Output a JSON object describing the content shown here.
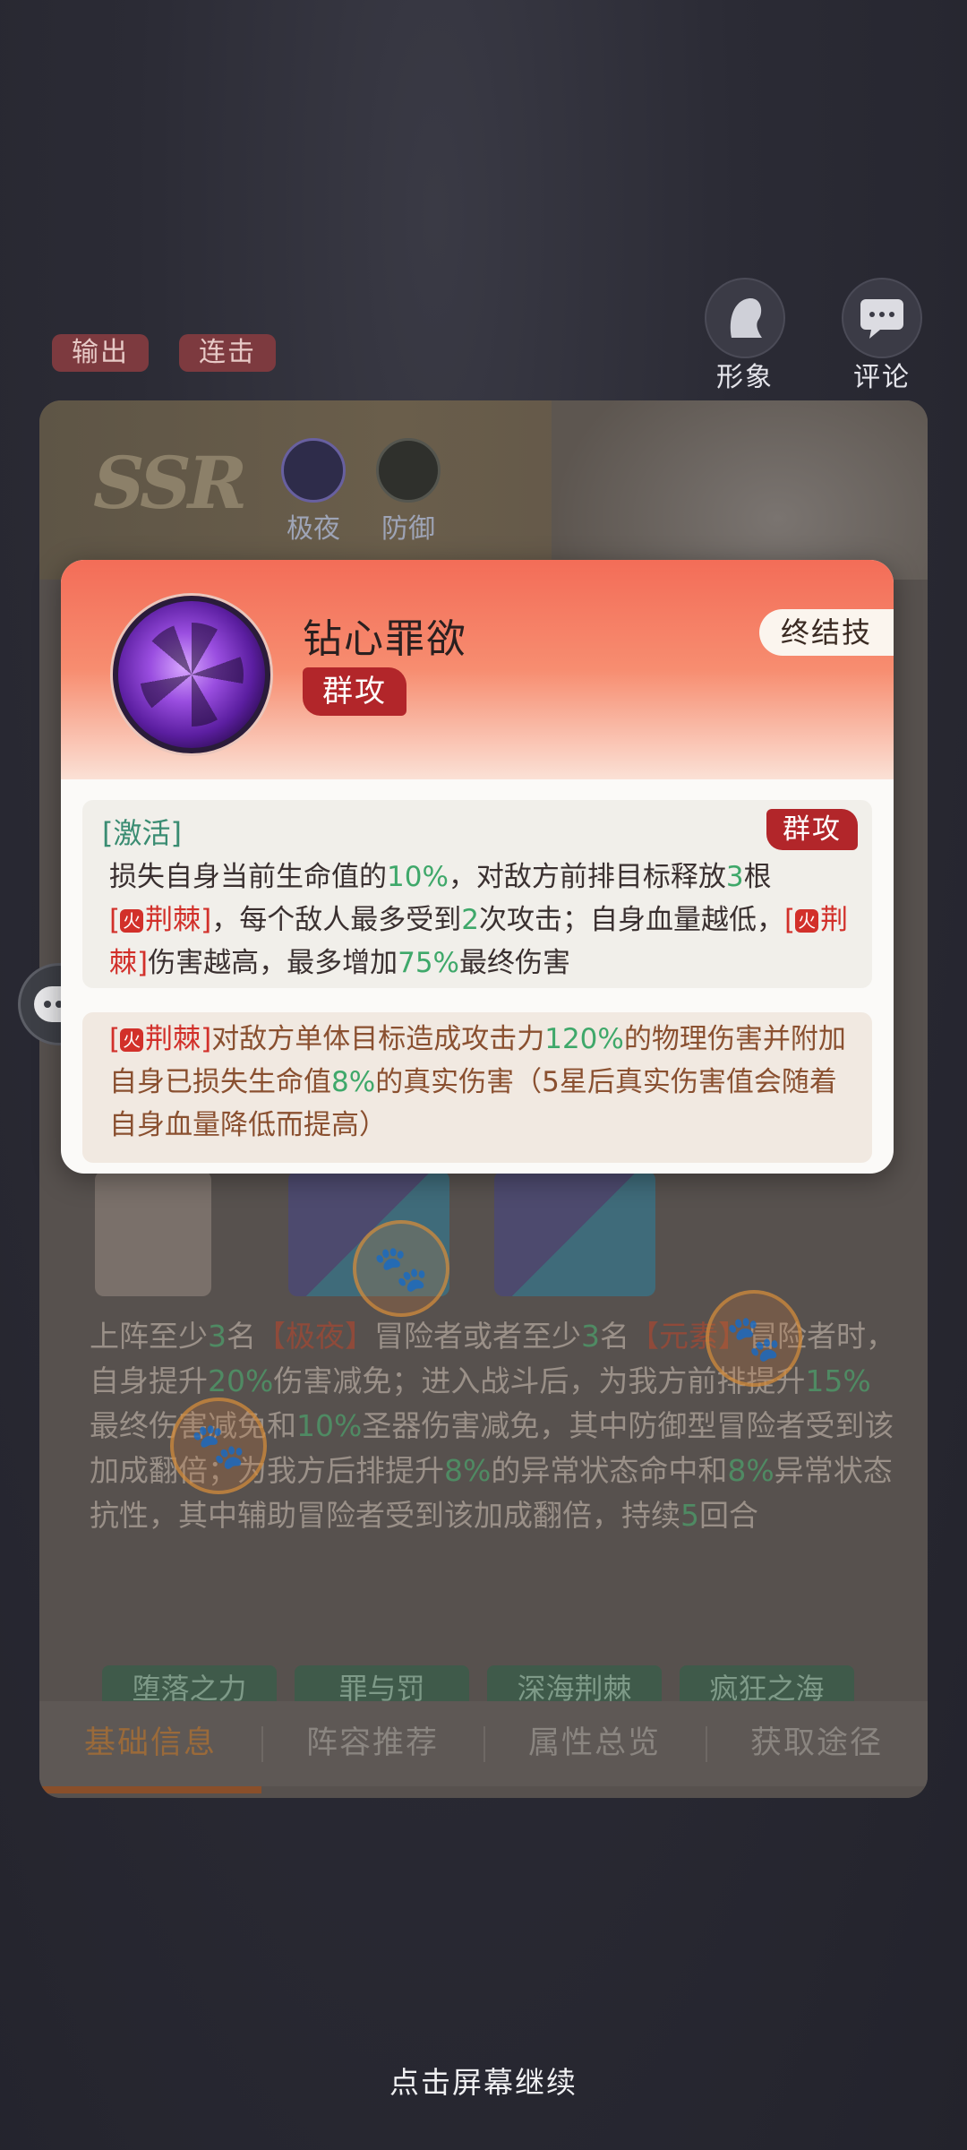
{
  "top_tags": [
    "输出",
    "连击"
  ],
  "top_buttons": [
    {
      "label": "形象",
      "icon": "portrait-icon"
    },
    {
      "label": "评论",
      "icon": "comment-icon"
    }
  ],
  "card": {
    "rarity": "SSR",
    "attributes": [
      {
        "label": "极夜",
        "icon": "moon-icon"
      },
      {
        "label": "防御",
        "icon": "shield-icon"
      }
    ],
    "description": {
      "p1": "上阵至少",
      "n1": "3",
      "p2": "名",
      "t1": "【极夜】",
      "p3": "冒险者或者至少",
      "n2": "3",
      "p4": "名",
      "t2": "【元素】",
      "p5": "冒险者时，自身提升",
      "n3": "20%",
      "p6": "伤害减免；进入战斗后，为我方前排提升",
      "n4": "15%",
      "p7": "最终伤害减免和",
      "n5": "10%",
      "p8": "圣器伤害减免，其中防御型冒险者受到该加成翻倍；为我方后排提升",
      "n6": "8%",
      "p9": "的异常状态命中和",
      "n7": "8%",
      "p10": "异常状态抗性，其中辅助冒险者受到该加成翻倍，持续",
      "n8": "5",
      "p11": "回合"
    },
    "chips": [
      "堕落之力",
      "罪与罚",
      "深海荆棘",
      "疯狂之海"
    ],
    "tabs": [
      "基础信息",
      "阵容推荐",
      "属性总览",
      "获取途径"
    ],
    "selected_tab": 0
  },
  "popup": {
    "skill_name": "钻心罪欲",
    "skill_type": "群攻",
    "skill_category": "终结技",
    "section1": {
      "label": "[激活]",
      "badge": "群攻",
      "t1": "损失自身当前生命值的",
      "n1": "10%",
      "t2": "，对敌方前排目标释放",
      "n2": "3",
      "t3": "根",
      "thorn1": "荆棘",
      "t4": "，每个敌人最多受到",
      "n3": "2",
      "t5": "次攻击；自身血量越低，",
      "thorn2": "荆棘",
      "t6": "伤害越高，最多增加",
      "n4": "75%",
      "t7": "最终伤害"
    },
    "section2": {
      "thorn": "荆棘",
      "t1": "对敌方单体目标造成攻击力",
      "n1": "120%",
      "t2": "的物理伤害并附加自身已损失生命值",
      "n2": "8%",
      "t3": "的真实伤害（5星后真实伤害值会随着自身血量降低而提高）"
    }
  },
  "footer_hint": "点击屏幕继续",
  "colors": {
    "accent_red": "#b2262a",
    "number_green": "#3fa86a",
    "thorn_red": "#d2302a",
    "popup_header": "#f36d58"
  }
}
